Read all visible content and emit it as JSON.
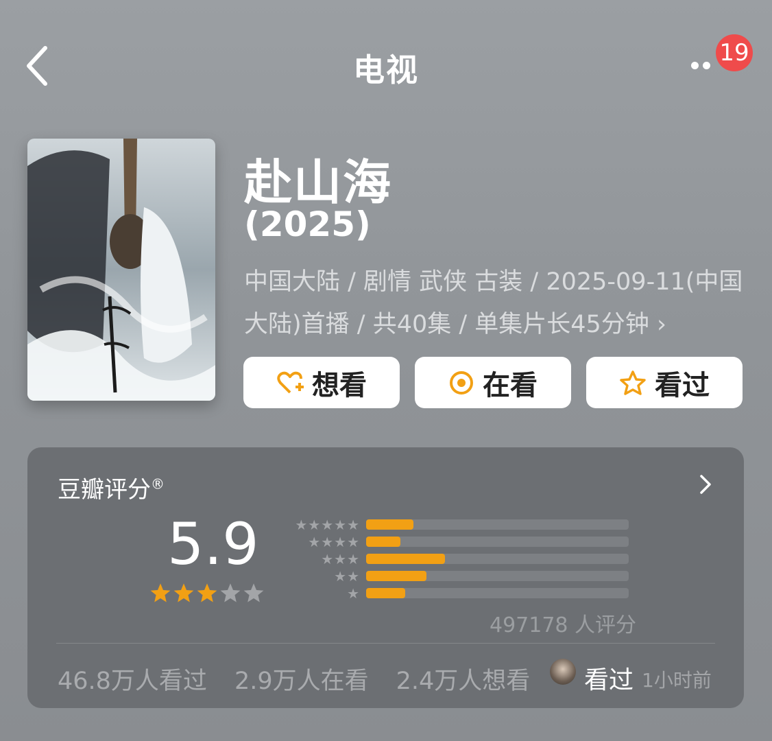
{
  "header": {
    "title": "电视",
    "notification_count": "19"
  },
  "show": {
    "title": "赴山海",
    "year": "(2025)",
    "meta": "中国大陆 / 剧情 武侠 古装 / 2025-09-11(中国大陆)首播 / 共40集 / 单集片长45分钟 ›"
  },
  "actions": {
    "want": "想看",
    "watching": "在看",
    "watched": "看过"
  },
  "rating": {
    "label": "豆瓣评分",
    "registered": "®",
    "score": "5.9",
    "stars_filled": 3,
    "stars_total": 5,
    "distribution": [
      {
        "stars": 5,
        "percent": 18
      },
      {
        "stars": 4,
        "percent": 13
      },
      {
        "stars": 3,
        "percent": 30
      },
      {
        "stars": 2,
        "percent": 23
      },
      {
        "stars": 1,
        "percent": 15
      }
    ],
    "count_text": "497178 人评分"
  },
  "stats": {
    "watched": "46.8万人看过",
    "watching": "2.9万人在看",
    "want": "2.4万人想看"
  },
  "recent": {
    "status": "看过",
    "time": "1小时前"
  },
  "colors": {
    "accent": "#f2a014",
    "badge": "#ef4b4b"
  },
  "icons": [
    "back-arrow-icon",
    "more-dots-icon",
    "heart-plus-icon",
    "watching-circle-icon",
    "star-icon",
    "chevron-right-icon"
  ]
}
